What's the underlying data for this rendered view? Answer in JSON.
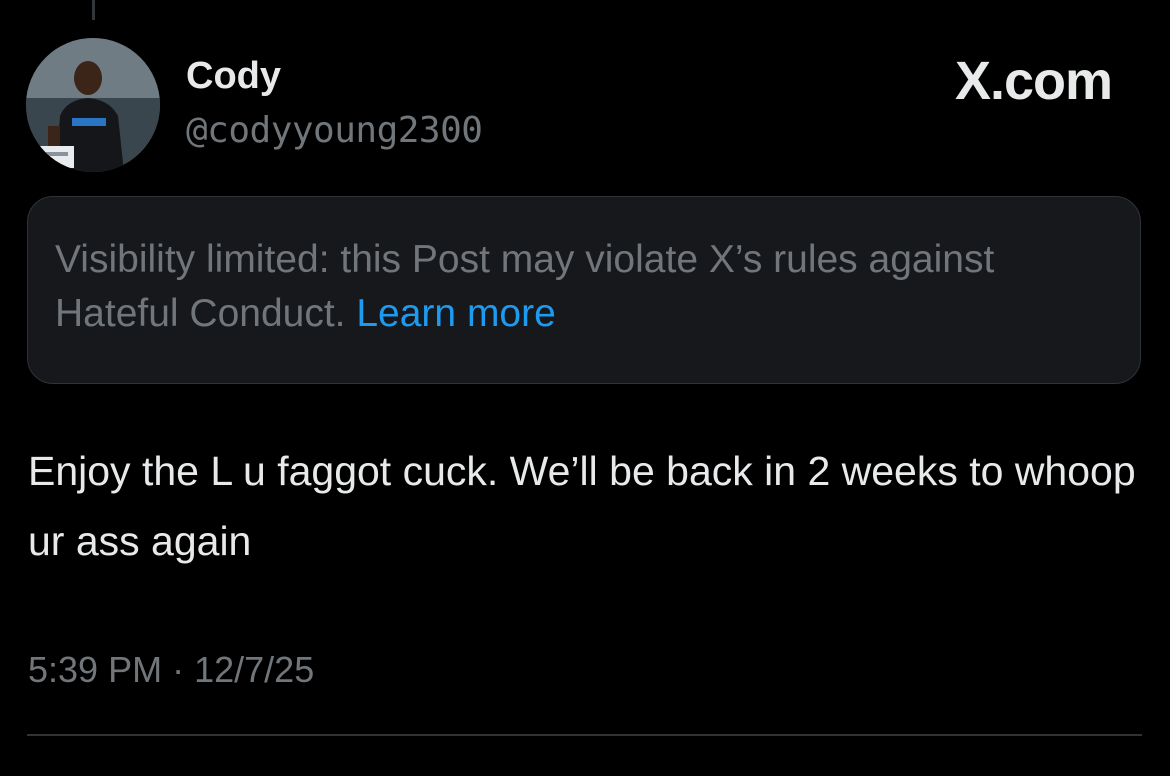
{
  "post": {
    "author": {
      "display_name": "Cody",
      "handle": "@codyyoung2300"
    },
    "brand": "X.com",
    "notice": {
      "text": "Visibility limited: this Post may violate X’s rules against Hateful Conduct.",
      "link_label": "Learn more"
    },
    "body": "Enjoy the L u faggot cuck. We’ll be back in 2 weeks to whoop ur ass again",
    "time": "5:39 PM",
    "separator": "·",
    "date": "12/7/25"
  },
  "colors": {
    "background": "#000000",
    "text_primary": "#e7e9ea",
    "text_secondary": "#71767b",
    "link": "#1d9bf0",
    "notice_bg": "#16181c",
    "border": "#2f3336"
  }
}
